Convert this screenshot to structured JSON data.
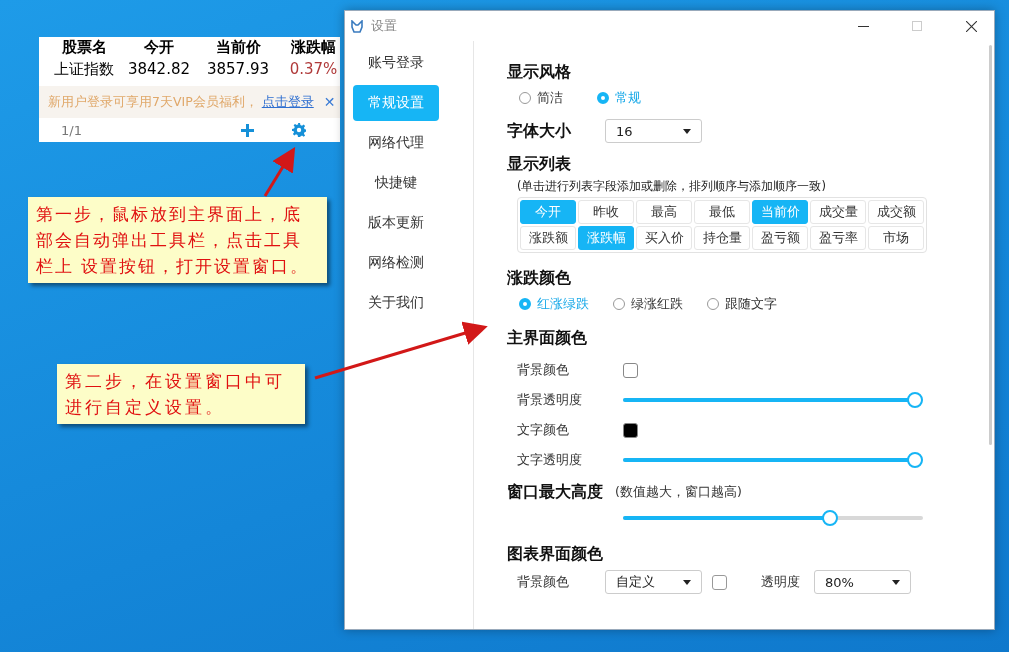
{
  "stock_widget": {
    "columns": [
      "股票名",
      "今开",
      "当前价",
      "涨跌幅"
    ],
    "rows": [
      {
        "cells": [
          "上证指数",
          "3842.82",
          "3857.93",
          "0.37%"
        ],
        "color": "#b03a3a"
      }
    ],
    "promo": {
      "text": "新用户登录可享用7天VIP会员福利，",
      "link": "点击登录",
      "close": "✕"
    },
    "page": "1/1"
  },
  "settings_window": {
    "title": "设置",
    "sidebar": [
      {
        "label": "账号登录",
        "selected": false
      },
      {
        "label": "常规设置",
        "selected": true
      },
      {
        "label": "网络代理",
        "selected": false
      },
      {
        "label": "快捷键",
        "selected": false
      },
      {
        "label": "版本更新",
        "selected": false
      },
      {
        "label": "网络检测",
        "selected": false
      },
      {
        "label": "关于我们",
        "selected": false
      }
    ],
    "display_style": {
      "title": "显示风格",
      "options": [
        {
          "label": "简洁",
          "selected": false
        },
        {
          "label": "常规",
          "selected": true
        }
      ]
    },
    "font_size": {
      "title": "字体大小",
      "value": "16"
    },
    "display_list": {
      "title": "显示列表",
      "hint": "(单击进行列表字段添加或删除，排列顺序与添加顺序一致)",
      "fields": [
        {
          "label": "今开",
          "selected": true
        },
        {
          "label": "昨收",
          "selected": false
        },
        {
          "label": "最高",
          "selected": false
        },
        {
          "label": "最低",
          "selected": false
        },
        {
          "label": "当前价",
          "selected": true
        },
        {
          "label": "成交量",
          "selected": false
        },
        {
          "label": "成交额",
          "selected": false
        },
        {
          "label": "涨跌额",
          "selected": false
        },
        {
          "label": "涨跌幅",
          "selected": true
        },
        {
          "label": "买入价",
          "selected": false
        },
        {
          "label": "持仓量",
          "selected": false
        },
        {
          "label": "盈亏额",
          "selected": false
        },
        {
          "label": "盈亏率",
          "selected": false
        },
        {
          "label": "市场",
          "selected": false
        }
      ]
    },
    "change_color": {
      "title": "涨跌颜色",
      "options": [
        {
          "label": "红涨绿跌",
          "selected": true
        },
        {
          "label": "绿涨红跌",
          "selected": false
        },
        {
          "label": "跟随文字",
          "selected": false
        }
      ]
    },
    "main_colors": {
      "title": "主界面颜色",
      "rows": [
        {
          "kind": "color",
          "label": "背景颜色",
          "color": "#ffffff"
        },
        {
          "kind": "slider",
          "label": "背景透明度",
          "level": 1
        },
        {
          "kind": "color",
          "label": "文字颜色",
          "color": "#000000"
        },
        {
          "kind": "slider",
          "label": "文字透明度",
          "level": 1
        }
      ]
    },
    "max_height": {
      "title": "窗口最大高度",
      "hint": "(数值越大，窗口越高)",
      "level": 0.7
    },
    "chart_colors": {
      "title": "图表界面颜色",
      "label": "背景颜色",
      "mode": "自定义",
      "color": "#ffffff",
      "opacity_label": "透明度",
      "opacity": "80%"
    }
  },
  "callouts": [
    {
      "text": "第一步，鼠标放到主界面上，底部会自动弹出工具栏，点击工具栏上 设置按钮，打开设置窗口。"
    },
    {
      "text": "第二步，在设置窗口中可进行自定义设置。"
    }
  ]
}
